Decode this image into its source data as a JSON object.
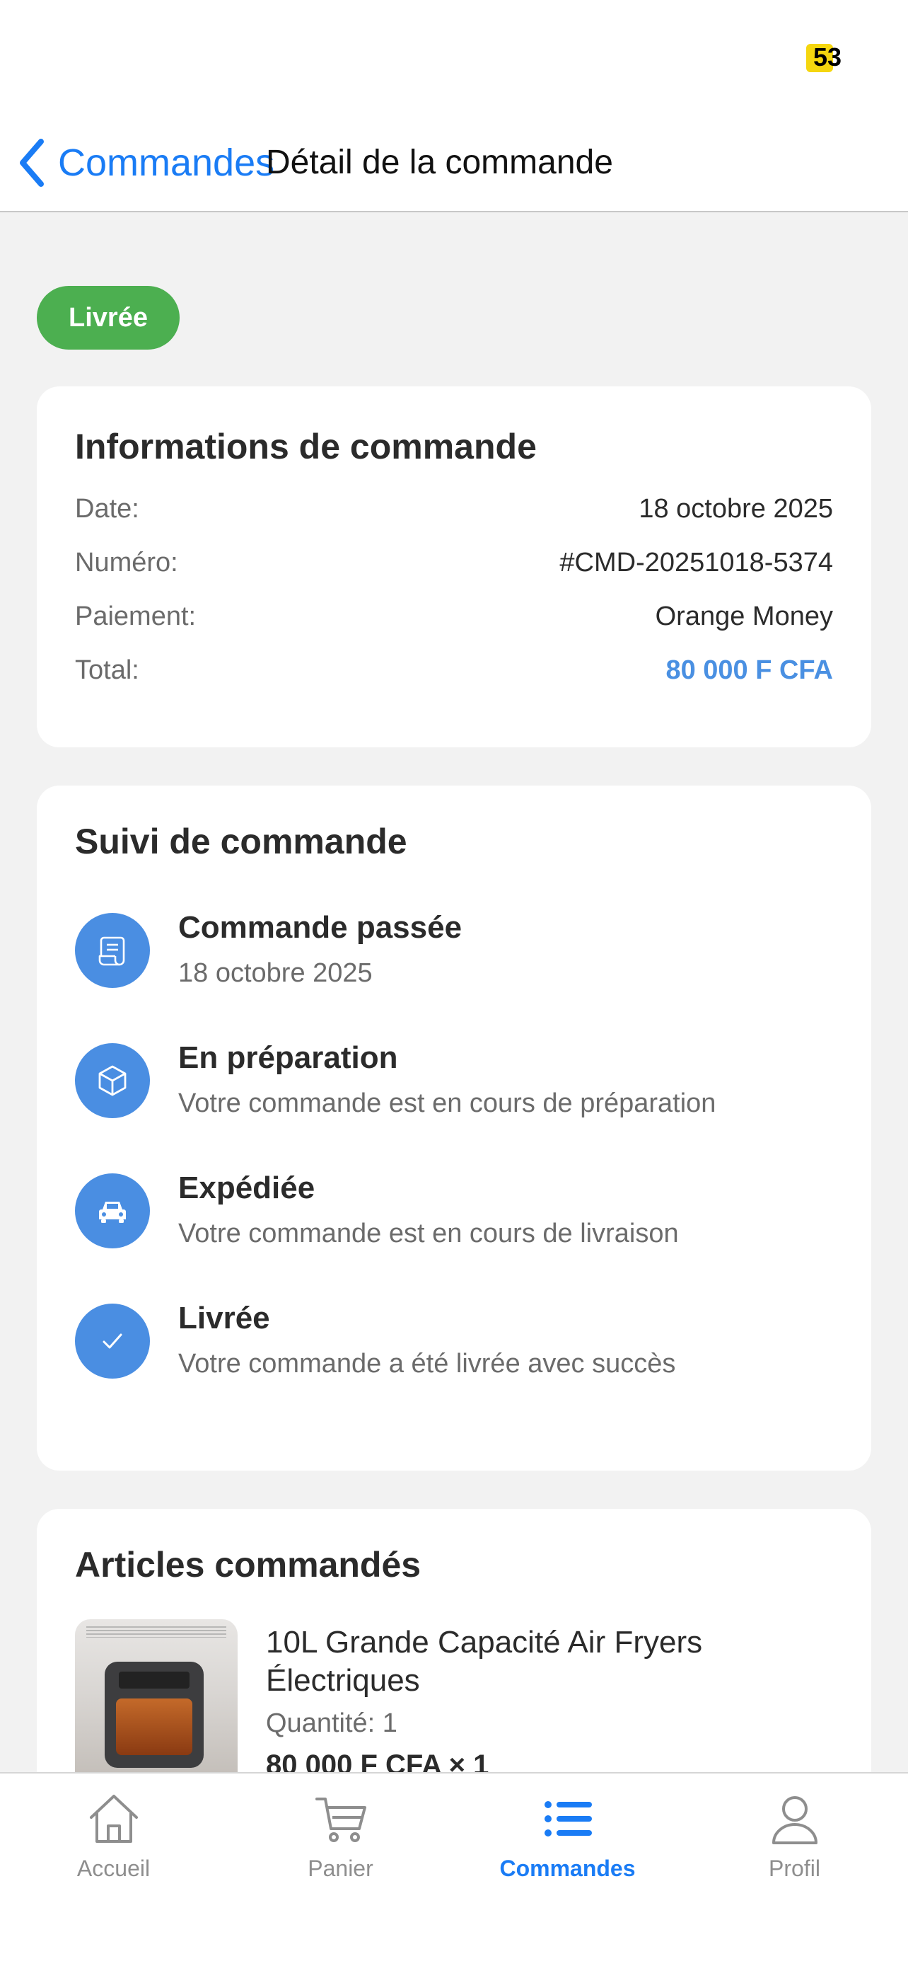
{
  "status_bar": {
    "badge": "53"
  },
  "nav": {
    "back_label": "Commandes",
    "title": "Détail de la commande"
  },
  "order_status": "Livrée",
  "info": {
    "title": "Informations de commande",
    "rows": [
      {
        "label": "Date:",
        "value": "18 octobre 2025"
      },
      {
        "label": "Numéro:",
        "value": "#CMD-20251018-5374"
      },
      {
        "label": "Paiement:",
        "value": "Orange Money"
      },
      {
        "label": "Total:",
        "value": "80 000 F CFA"
      }
    ]
  },
  "tracking": {
    "title": "Suivi de commande",
    "steps": [
      {
        "title": "Commande passée",
        "subtitle": "18 octobre 2025",
        "icon": "receipt-icon"
      },
      {
        "title": "En préparation",
        "subtitle": "Votre commande est en cours de préparation",
        "icon": "box-icon"
      },
      {
        "title": "Expédiée",
        "subtitle": "Votre commande est en cours de livraison",
        "icon": "car-icon"
      },
      {
        "title": "Livrée",
        "subtitle": "Votre commande a été livrée avec succès",
        "icon": "checkmark-icon"
      }
    ]
  },
  "items": {
    "title": "Articles commandés",
    "products": [
      {
        "name": "10L Grande Capacité Air Fryers Électriques",
        "quantity": "Quantité: 1",
        "price": "80 000 F CFA × 1"
      }
    ]
  },
  "tabs": [
    {
      "label": "Accueil",
      "icon": "home-icon",
      "active": false
    },
    {
      "label": "Panier",
      "icon": "cart-icon",
      "active": false
    },
    {
      "label": "Commandes",
      "icon": "list-icon",
      "active": true
    },
    {
      "label": "Profil",
      "icon": "person-icon",
      "active": false
    }
  ],
  "colors": {
    "accent": "#1a7cf5",
    "status_green": "#4caf50",
    "track_icon": "#4a8ee2",
    "total_blue": "#4a90e2"
  }
}
